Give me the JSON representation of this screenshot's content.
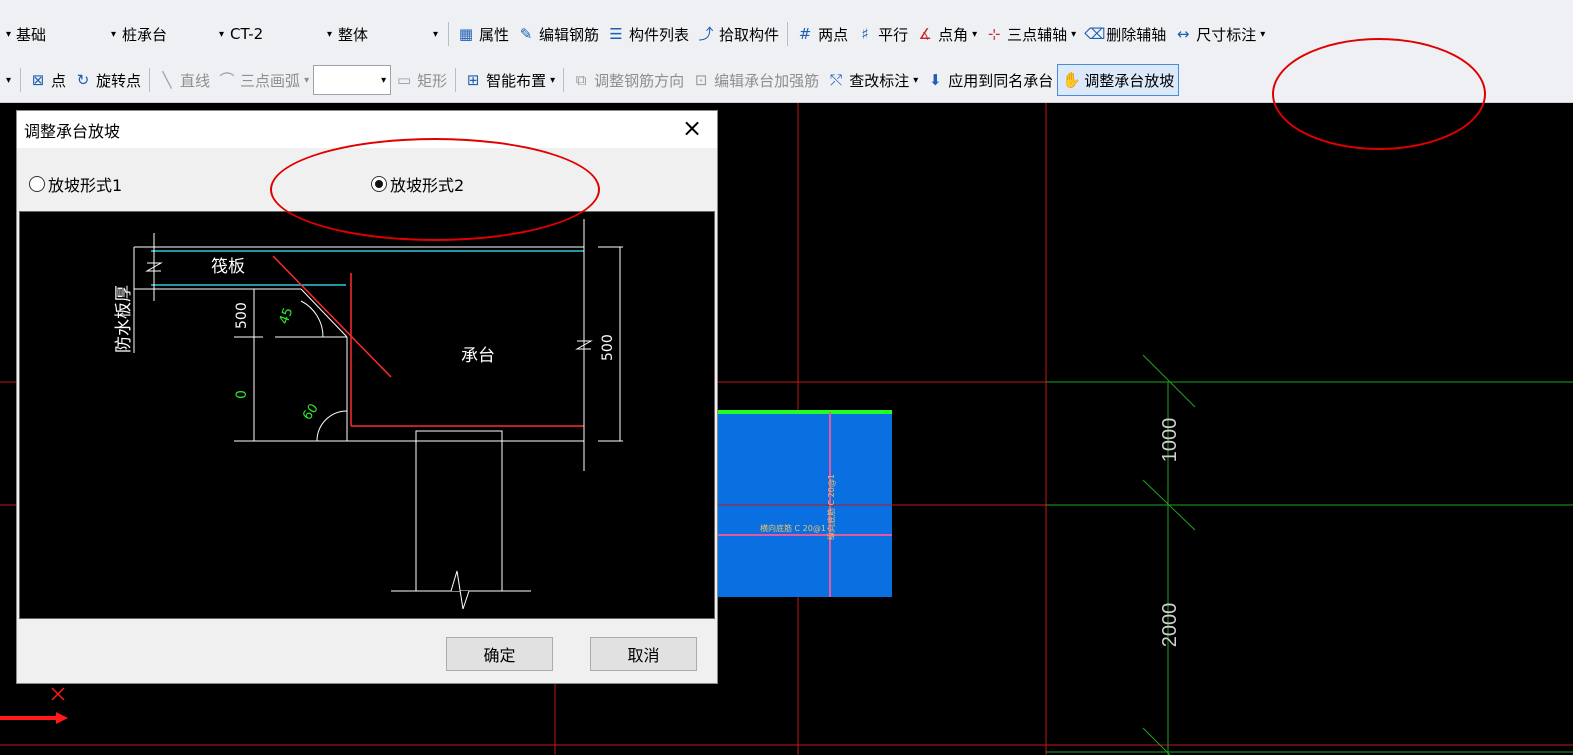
{
  "toolbar1": {
    "items": {
      "jichu": "基础",
      "zhuchengtai": "桩承台",
      "ct2": "CT-2",
      "zhengti": "整体",
      "shuxing": "属性",
      "bianji_gangjin": "编辑钢筋",
      "goujian_liebiao": "构件列表",
      "shiqu_goujian": "拾取构件",
      "liangdian": "两点",
      "pingxing": "平行",
      "dianjiao": "点角",
      "sandian_fuzhou": "三点辅轴",
      "shanchu_fuzhou": "删除辅轴",
      "chicun_biaozhu": "尺寸标注"
    }
  },
  "toolbar2": {
    "items": {
      "dian": "点",
      "xuanzhuandian": "旋转点",
      "zhixian": "直线",
      "sandian_huahu": "三点画弧",
      "juxing": "矩形",
      "zhineng_buzhi": "智能布置",
      "tiaozheng_gangjin_fangxiang": "调整钢筋方向",
      "bianji_chengtai_jiaqiangjin": "编辑承台加强筋",
      "chagai_biaozhu": "查改标注",
      "yingyong_tongming": "应用到同名承台",
      "tiaozheng_chengtai_fangpo": "调整承台放坡"
    }
  },
  "dialog": {
    "title": "调整承台放坡",
    "radio1": "放坡形式1",
    "radio2": "放坡形式2",
    "selected": "放坡形式2",
    "ok": "确定",
    "cancel": "取消",
    "diagram": {
      "fabang": "筏板",
      "fangshui_banhou": "防水板厚",
      "chengtai": "承台",
      "dim_500_left": "500",
      "dim_0": "0",
      "angle_45": "45",
      "angle_60": "60",
      "dim_500_right": "500"
    }
  },
  "canvas": {
    "dim_1000": "1000",
    "dim_2000": "2000",
    "pile_text": "横向底筋 C 20@1",
    "pile_text_v": "纵向底筋 C 20@1"
  }
}
